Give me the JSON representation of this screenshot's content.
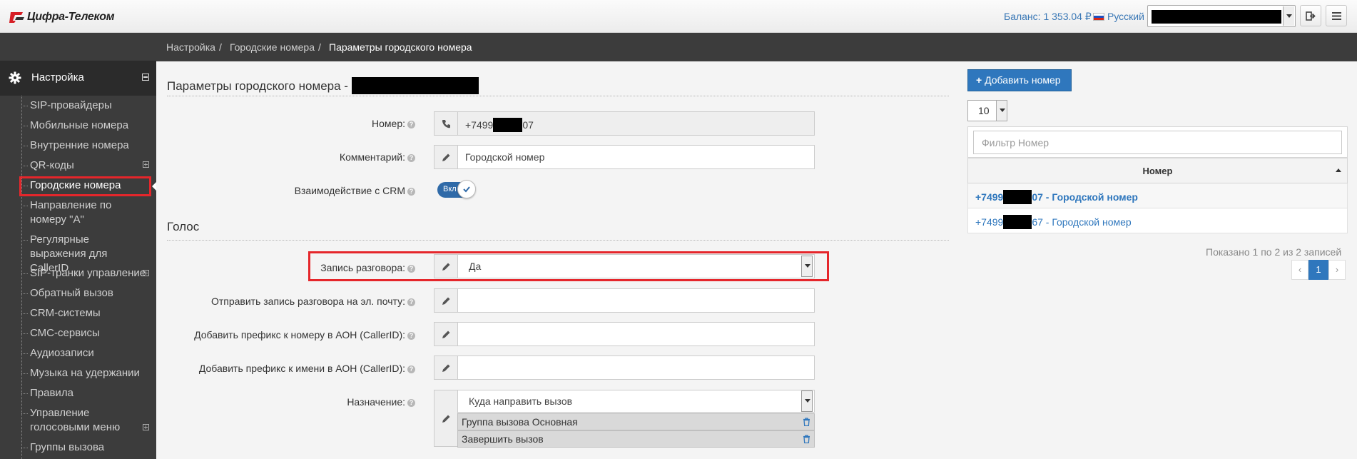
{
  "header": {
    "logo_text": "Цифра-Телеком",
    "balance": "Баланс: 1 353.04 ₽",
    "language": "Русский"
  },
  "breadcrumb": [
    "Настройка",
    "/",
    "Городские номера",
    "/",
    "Параметры городского номера"
  ],
  "sidebar": {
    "section": "Настройка",
    "items": [
      {
        "label": "SIP-провайдеры"
      },
      {
        "label": "Мобильные номера"
      },
      {
        "label": "Внутренние номера"
      },
      {
        "label": "QR-коды"
      },
      {
        "label": "Городские номера"
      },
      {
        "label": "Направление по номеру \"А\""
      },
      {
        "label": "Регулярные выражения для CallerID"
      },
      {
        "label": "SIP-транки управление"
      },
      {
        "label": "Обратный вызов"
      },
      {
        "label": "CRM-системы"
      },
      {
        "label": "СМС-сервисы"
      },
      {
        "label": "Аудиозаписи"
      },
      {
        "label": "Музыка на удержании"
      },
      {
        "label": "Правила"
      },
      {
        "label": "Управление голосовыми меню"
      },
      {
        "label": "Группы вызова"
      }
    ]
  },
  "form": {
    "title": "Параметры городского номера -",
    "number_label": "Номер:",
    "number_prefix": "+7499",
    "number_suffix": "07",
    "comment_label": "Комментарий:",
    "comment_value": "Городской номер",
    "crm_label": "Взаимодействие с CRM",
    "crm_toggle": "Вкл",
    "voice_title": "Голос",
    "record_label": "Запись разговора:",
    "record_value": "Да",
    "email_label": "Отправить запись разговора на эл. почту:",
    "prefix_number_label": "Добавить префикс к номеру в АОН (CallerID):",
    "prefix_name_label": "Добавить префикс к имени в АОН (CallerID):",
    "destination_label": "Назначение:",
    "destination_placeholder": "Куда направить вызов",
    "destinations": [
      "Группа вызова Основная",
      "Завершить вызов"
    ]
  },
  "right_panel": {
    "add_button": "Добавить номер",
    "page_size": "10",
    "filter_placeholder": "Фильтр Номер",
    "column_header": "Номер",
    "rows": [
      {
        "prefix": "+7499",
        "suffix": "07 - Городской номер"
      },
      {
        "prefix": "+7499",
        "suffix": "67 - Городской номер"
      }
    ],
    "info": "Показано 1 по 2 из 2 записей",
    "pagination": {
      "prev": "‹",
      "current": "1",
      "next": "›"
    }
  },
  "colors": {
    "accent": "#2f77bd",
    "highlight": "#e5262b",
    "sidebar": "#3c3c3c"
  }
}
